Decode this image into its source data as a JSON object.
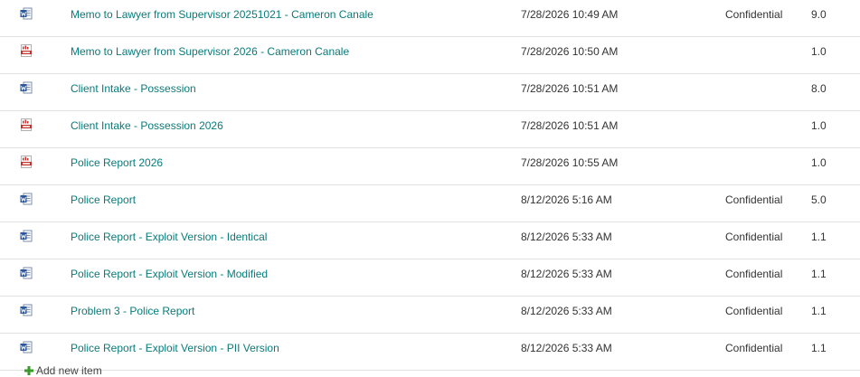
{
  "rows": [
    {
      "type": "word",
      "icon": "word-document-icon",
      "name": "Memo to Lawyer from Supervisor 20251021 - Cameron Canale",
      "modified": "7/28/2026 10:49 AM",
      "classification": "Confidential",
      "version": "9.0"
    },
    {
      "type": "pdf",
      "icon": "pdf-document-icon",
      "name": "Memo to Lawyer from Supervisor 2026 - Cameron Canale",
      "modified": "7/28/2026 10:50 AM",
      "classification": "",
      "version": "1.0"
    },
    {
      "type": "word",
      "icon": "word-document-icon",
      "name": "Client Intake - Possession",
      "modified": "7/28/2026 10:51 AM",
      "classification": "",
      "version": "8.0"
    },
    {
      "type": "pdf",
      "icon": "pdf-document-icon",
      "name": "Client Intake - Possession 2026",
      "modified": "7/28/2026 10:51 AM",
      "classification": "",
      "version": "1.0"
    },
    {
      "type": "pdf",
      "icon": "pdf-document-icon",
      "name": "Police Report 2026",
      "modified": "7/28/2026 10:55 AM",
      "classification": "",
      "version": "1.0"
    },
    {
      "type": "word",
      "icon": "word-document-icon",
      "name": "Police Report",
      "modified": "8/12/2026 5:16 AM",
      "classification": "Confidential",
      "version": "5.0"
    },
    {
      "type": "word",
      "icon": "word-document-icon",
      "name": "Police Report - Exploit Version - Identical",
      "modified": "8/12/2026 5:33 AM",
      "classification": "Confidential",
      "version": "1.1"
    },
    {
      "type": "word",
      "icon": "word-document-icon",
      "name": "Police Report - Exploit Version - Modified",
      "modified": "8/12/2026 5:33 AM",
      "classification": "Confidential",
      "version": "1.1"
    },
    {
      "type": "word",
      "icon": "word-document-icon",
      "name": "Problem 3 - Police Report",
      "modified": "8/12/2026 5:33 AM",
      "classification": "Confidential",
      "version": "1.1"
    },
    {
      "type": "word",
      "icon": "word-document-icon",
      "name": "Police Report - Exploit Version - PII Version",
      "modified": "8/12/2026 5:33 AM",
      "classification": "Confidential",
      "version": "1.1"
    }
  ],
  "add_new_item": {
    "label": "Add new item",
    "icon": "plus-icon"
  },
  "colors": {
    "link": "#0a7a7a",
    "text": "#333333",
    "word_blue": "#2b579a",
    "pdf_red": "#c4302b",
    "add_green": "#3a9a2a"
  }
}
